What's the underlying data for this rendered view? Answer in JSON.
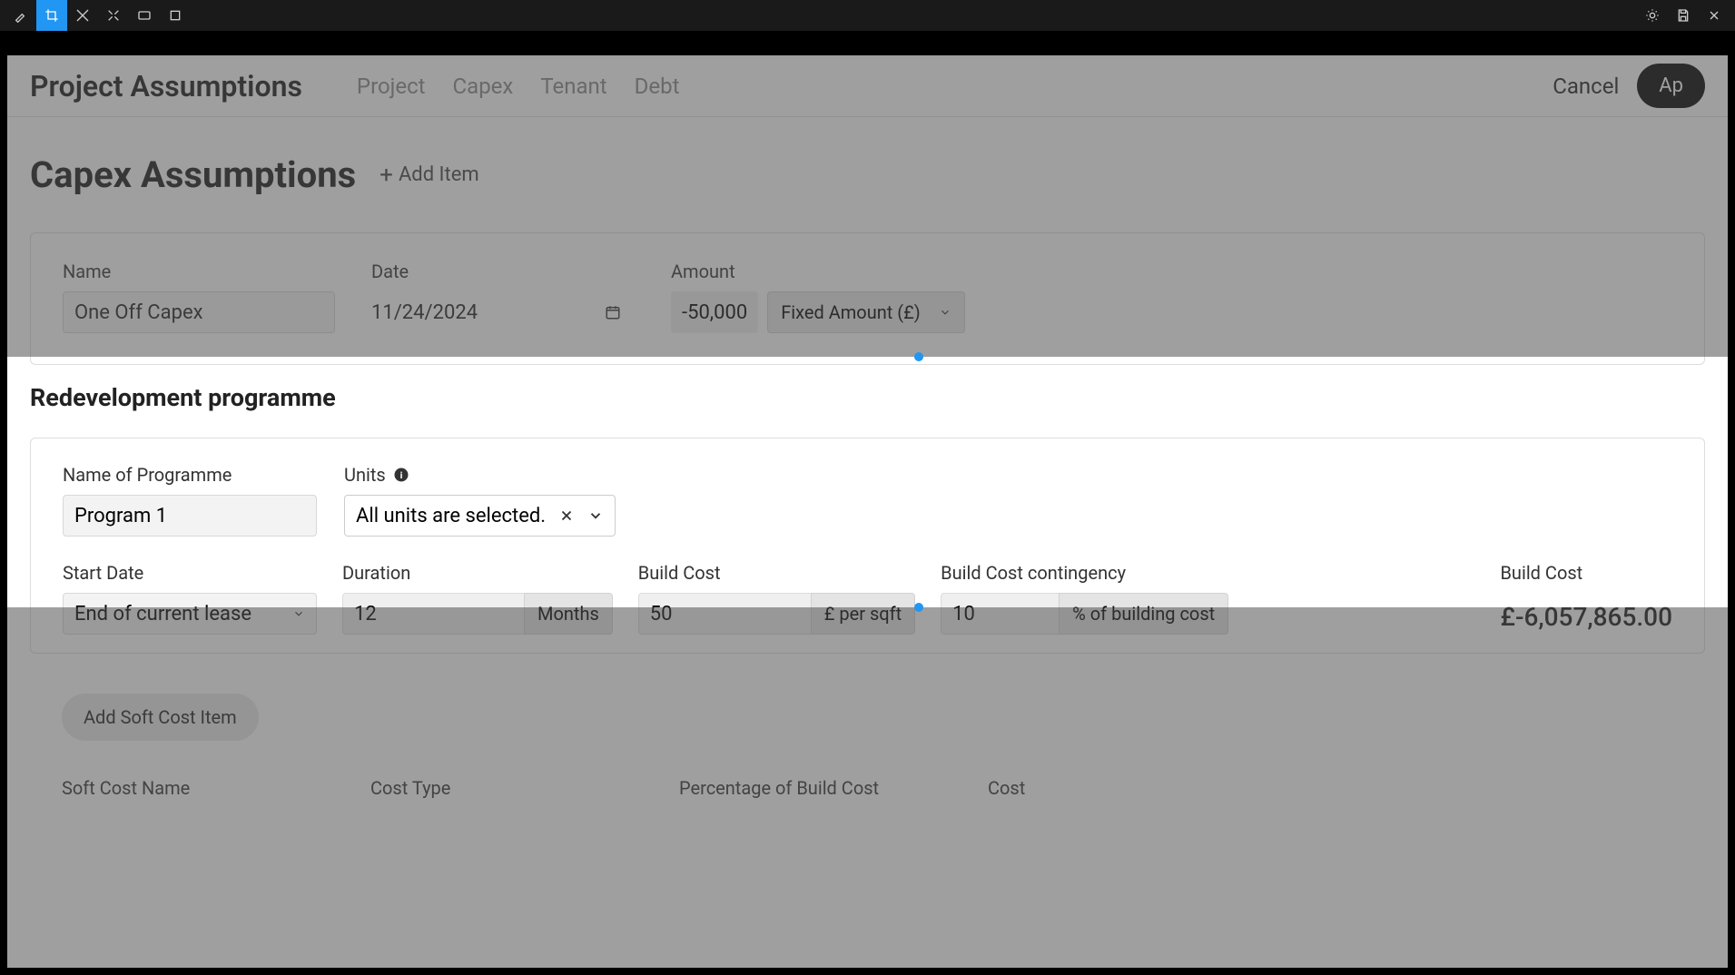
{
  "toolbar": {
    "icons": [
      "brush",
      "crop",
      "eraser",
      "expand",
      "screen",
      "stop"
    ],
    "right_icons": [
      "sun",
      "save",
      "close"
    ]
  },
  "header": {
    "title": "Project Assumptions",
    "tabs": [
      "Project",
      "Capex",
      "Tenant",
      "Debt"
    ],
    "cancel": "Cancel",
    "apply": "Ap"
  },
  "capex": {
    "title": "Capex Assumptions",
    "add_item": "Add Item",
    "cols": {
      "name": "Name",
      "date": "Date",
      "amount": "Amount"
    },
    "row": {
      "name": "One Off Capex",
      "date": "11/24/2024",
      "amount": "-50,000",
      "amount_type": "Fixed Amount (£)"
    }
  },
  "redev": {
    "title": "Redevelopment programme",
    "labels": {
      "name": "Name of Programme",
      "units": "Units",
      "start": "Start Date",
      "duration": "Duration",
      "buildcost": "Build Cost",
      "contingency": "Build Cost contingency",
      "bc_total": "Build Cost"
    },
    "program_name": "Program 1",
    "units_text": "All units are selected.",
    "start_date": "End of current lease",
    "duration_val": "12",
    "duration_unit": "Months",
    "buildcost_val": "50",
    "buildcost_unit": "£ per sqft",
    "contingency_val": "10",
    "contingency_unit": "% of building cost",
    "bc_total_val": "£-6,057,865.00"
  },
  "softcost": {
    "add_btn": "Add Soft Cost Item",
    "cols": {
      "name": "Soft Cost Name",
      "type": "Cost Type",
      "pct": "Percentage of Build Cost",
      "cost": "Cost"
    }
  }
}
